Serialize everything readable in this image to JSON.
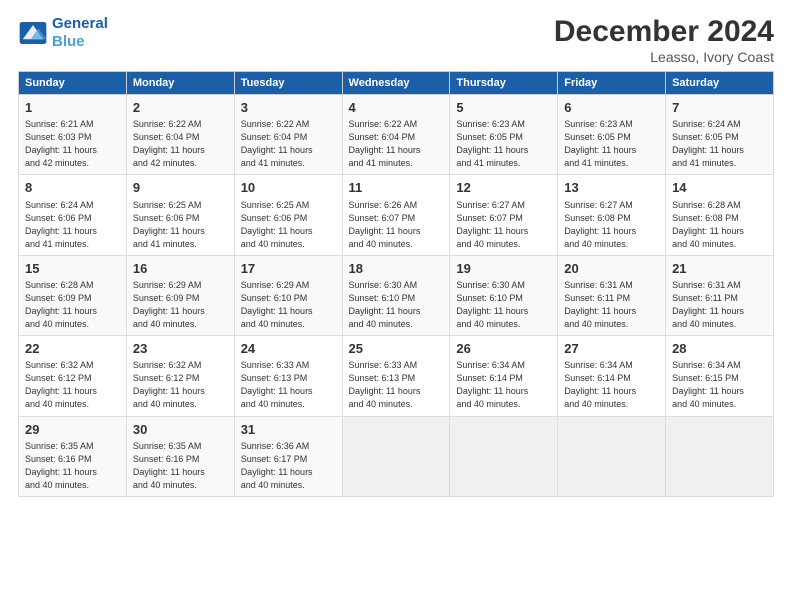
{
  "logo": {
    "line1": "General",
    "line2": "Blue"
  },
  "title": "December 2024",
  "subtitle": "Leasso, Ivory Coast",
  "days_of_week": [
    "Sunday",
    "Monday",
    "Tuesday",
    "Wednesday",
    "Thursday",
    "Friday",
    "Saturday"
  ],
  "weeks": [
    [
      {
        "day": "1",
        "info": "Sunrise: 6:21 AM\nSunset: 6:03 PM\nDaylight: 11 hours\nand 42 minutes."
      },
      {
        "day": "2",
        "info": "Sunrise: 6:22 AM\nSunset: 6:04 PM\nDaylight: 11 hours\nand 42 minutes."
      },
      {
        "day": "3",
        "info": "Sunrise: 6:22 AM\nSunset: 6:04 PM\nDaylight: 11 hours\nand 41 minutes."
      },
      {
        "day": "4",
        "info": "Sunrise: 6:22 AM\nSunset: 6:04 PM\nDaylight: 11 hours\nand 41 minutes."
      },
      {
        "day": "5",
        "info": "Sunrise: 6:23 AM\nSunset: 6:05 PM\nDaylight: 11 hours\nand 41 minutes."
      },
      {
        "day": "6",
        "info": "Sunrise: 6:23 AM\nSunset: 6:05 PM\nDaylight: 11 hours\nand 41 minutes."
      },
      {
        "day": "7",
        "info": "Sunrise: 6:24 AM\nSunset: 6:05 PM\nDaylight: 11 hours\nand 41 minutes."
      }
    ],
    [
      {
        "day": "8",
        "info": "Sunrise: 6:24 AM\nSunset: 6:06 PM\nDaylight: 11 hours\nand 41 minutes."
      },
      {
        "day": "9",
        "info": "Sunrise: 6:25 AM\nSunset: 6:06 PM\nDaylight: 11 hours\nand 41 minutes."
      },
      {
        "day": "10",
        "info": "Sunrise: 6:25 AM\nSunset: 6:06 PM\nDaylight: 11 hours\nand 40 minutes."
      },
      {
        "day": "11",
        "info": "Sunrise: 6:26 AM\nSunset: 6:07 PM\nDaylight: 11 hours\nand 40 minutes."
      },
      {
        "day": "12",
        "info": "Sunrise: 6:27 AM\nSunset: 6:07 PM\nDaylight: 11 hours\nand 40 minutes."
      },
      {
        "day": "13",
        "info": "Sunrise: 6:27 AM\nSunset: 6:08 PM\nDaylight: 11 hours\nand 40 minutes."
      },
      {
        "day": "14",
        "info": "Sunrise: 6:28 AM\nSunset: 6:08 PM\nDaylight: 11 hours\nand 40 minutes."
      }
    ],
    [
      {
        "day": "15",
        "info": "Sunrise: 6:28 AM\nSunset: 6:09 PM\nDaylight: 11 hours\nand 40 minutes."
      },
      {
        "day": "16",
        "info": "Sunrise: 6:29 AM\nSunset: 6:09 PM\nDaylight: 11 hours\nand 40 minutes."
      },
      {
        "day": "17",
        "info": "Sunrise: 6:29 AM\nSunset: 6:10 PM\nDaylight: 11 hours\nand 40 minutes."
      },
      {
        "day": "18",
        "info": "Sunrise: 6:30 AM\nSunset: 6:10 PM\nDaylight: 11 hours\nand 40 minutes."
      },
      {
        "day": "19",
        "info": "Sunrise: 6:30 AM\nSunset: 6:10 PM\nDaylight: 11 hours\nand 40 minutes."
      },
      {
        "day": "20",
        "info": "Sunrise: 6:31 AM\nSunset: 6:11 PM\nDaylight: 11 hours\nand 40 minutes."
      },
      {
        "day": "21",
        "info": "Sunrise: 6:31 AM\nSunset: 6:11 PM\nDaylight: 11 hours\nand 40 minutes."
      }
    ],
    [
      {
        "day": "22",
        "info": "Sunrise: 6:32 AM\nSunset: 6:12 PM\nDaylight: 11 hours\nand 40 minutes."
      },
      {
        "day": "23",
        "info": "Sunrise: 6:32 AM\nSunset: 6:12 PM\nDaylight: 11 hours\nand 40 minutes."
      },
      {
        "day": "24",
        "info": "Sunrise: 6:33 AM\nSunset: 6:13 PM\nDaylight: 11 hours\nand 40 minutes."
      },
      {
        "day": "25",
        "info": "Sunrise: 6:33 AM\nSunset: 6:13 PM\nDaylight: 11 hours\nand 40 minutes."
      },
      {
        "day": "26",
        "info": "Sunrise: 6:34 AM\nSunset: 6:14 PM\nDaylight: 11 hours\nand 40 minutes."
      },
      {
        "day": "27",
        "info": "Sunrise: 6:34 AM\nSunset: 6:14 PM\nDaylight: 11 hours\nand 40 minutes."
      },
      {
        "day": "28",
        "info": "Sunrise: 6:34 AM\nSunset: 6:15 PM\nDaylight: 11 hours\nand 40 minutes."
      }
    ],
    [
      {
        "day": "29",
        "info": "Sunrise: 6:35 AM\nSunset: 6:16 PM\nDaylight: 11 hours\nand 40 minutes."
      },
      {
        "day": "30",
        "info": "Sunrise: 6:35 AM\nSunset: 6:16 PM\nDaylight: 11 hours\nand 40 minutes."
      },
      {
        "day": "31",
        "info": "Sunrise: 6:36 AM\nSunset: 6:17 PM\nDaylight: 11 hours\nand 40 minutes."
      },
      {
        "day": "",
        "info": ""
      },
      {
        "day": "",
        "info": ""
      },
      {
        "day": "",
        "info": ""
      },
      {
        "day": "",
        "info": ""
      }
    ]
  ]
}
